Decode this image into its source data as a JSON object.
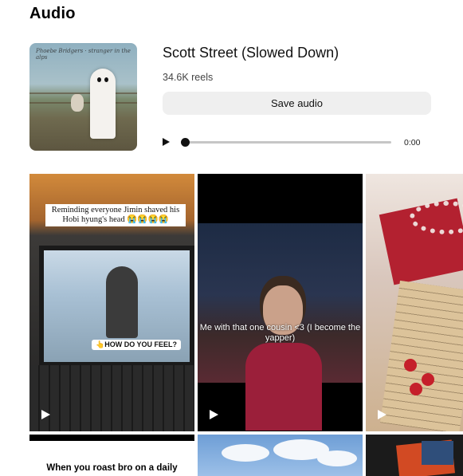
{
  "page": {
    "heading": "Audio"
  },
  "audio": {
    "title": "Scott Street (Slowed Down)",
    "reels_count": "34.6K reels",
    "save_label": "Save audio",
    "cover_text": "Phoebe Bridgers · stranger in the alps"
  },
  "player": {
    "time": "0:00",
    "progress": 0
  },
  "grid": {
    "tiles": [
      {
        "caption": "Reminding everyone Jimin shaved his Hobi hyung's head 😭😭😭😭",
        "sticker": "👆HOW DO YOU FEEL?"
      },
      {
        "caption": "Me with that one cousin <3 (I become the yapper)"
      },
      {
        "caption": ""
      },
      {
        "caption": "When you roast bro on a daily"
      },
      {
        "caption": ""
      },
      {
        "caption": ""
      }
    ]
  },
  "icons": {
    "play": "play-icon",
    "reel_play": "reel-play-icon"
  },
  "colors": {
    "button_bg": "#efefef",
    "progress_track": "#c6c6c6",
    "text": "#111111"
  }
}
